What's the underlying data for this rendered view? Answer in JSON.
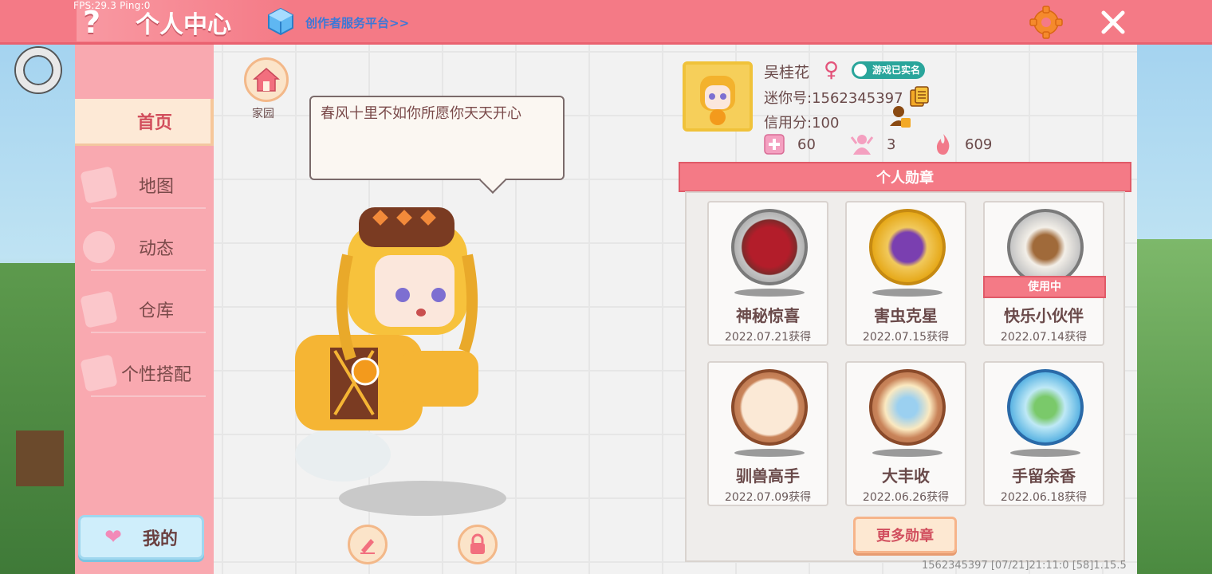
{
  "debug": {
    "fps": "FPS:29.3  Ping:0"
  },
  "header": {
    "help_icon": "?",
    "title": "个人中心",
    "creator_link": "创作者服务平台>>",
    "icons": {
      "settings": "gear-icon",
      "close": "close-icon",
      "creator": "cube-icon"
    }
  },
  "sidebar": {
    "items": [
      {
        "label": "首页",
        "active": true
      },
      {
        "label": "地图",
        "active": false
      },
      {
        "label": "动态",
        "active": false
      },
      {
        "label": "仓库",
        "active": false
      },
      {
        "label": "个性搭配",
        "active": false
      }
    ],
    "my_button": "我的"
  },
  "main": {
    "home_label": "家园",
    "signature": "春风十里不如你所愿你天天开心"
  },
  "profile": {
    "name": "吴桂花",
    "gender": "♀",
    "verify_badge": "游戏已实名",
    "mini_id": "迷你号:1562345397",
    "credit": "信用分:100",
    "stats": [
      {
        "icon": "plus-card-icon",
        "value": "60"
      },
      {
        "icon": "fans-icon",
        "value": "3"
      },
      {
        "icon": "flame-icon",
        "value": "609"
      }
    ]
  },
  "medals": {
    "header": "个人勋章",
    "in_use_label": "使用中",
    "items": [
      {
        "name": "神秘惊喜",
        "date": "2022.07.21获得",
        "style": "silver"
      },
      {
        "name": "害虫克星",
        "date": "2022.07.15获得",
        "style": "gold"
      },
      {
        "name": "快乐小伙伴",
        "date": "2022.07.14获得",
        "style": "silver",
        "in_use": true
      },
      {
        "name": "驯兽高手",
        "date": "2022.07.09获得",
        "style": "bronze"
      },
      {
        "name": "大丰收",
        "date": "2022.06.26获得",
        "style": "bronze"
      },
      {
        "name": "手留余香",
        "date": "2022.06.18获得",
        "style": "crystal"
      }
    ],
    "more_button": "更多勋章"
  },
  "footer": {
    "info": "1562345397    [07/21]21:11:0    [58]1.15.5"
  },
  "colors": {
    "accent": "#f47a86",
    "sidebar": "#f9a9b0",
    "link": "#3b78d8"
  }
}
